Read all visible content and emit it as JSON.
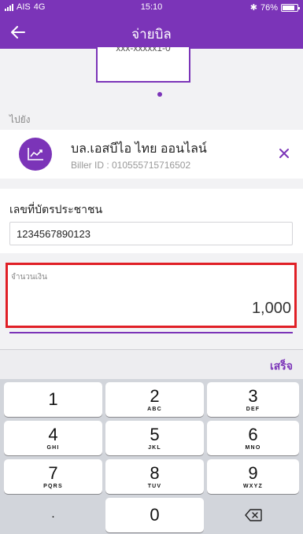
{
  "status_bar": {
    "carrier": "AIS",
    "network": "4G",
    "time": "15:10",
    "battery": "76%"
  },
  "header": {
    "title": "จ่ายบิล",
    "back_icon": "arrow-left-icon"
  },
  "preview": {
    "masked_text": "xxx-xxxxx1-0"
  },
  "destination_label": "ไปยัง",
  "biller": {
    "name": "บล.เอสบีไอ ไทย ออนไลน์",
    "id_text": "Biller ID : 010555715716502",
    "icon": "chart-line-icon",
    "remove_icon": "close-icon"
  },
  "id_card": {
    "label": "เลขที่บัตรประชาชน",
    "value": "1234567890123"
  },
  "amount": {
    "label": "จำนวนเงิน",
    "value": "1,000"
  },
  "keyboard": {
    "done_label": "เสร็จ",
    "keys": [
      {
        "num": "1",
        "letters": ""
      },
      {
        "num": "2",
        "letters": "ABC"
      },
      {
        "num": "3",
        "letters": "DEF"
      },
      {
        "num": "4",
        "letters": "GHI"
      },
      {
        "num": "5",
        "letters": "JKL"
      },
      {
        "num": "6",
        "letters": "MNO"
      },
      {
        "num": "7",
        "letters": "PQRS"
      },
      {
        "num": "8",
        "letters": "TUV"
      },
      {
        "num": "9",
        "letters": "WXYZ"
      },
      {
        "num": ".",
        "letters": ""
      },
      {
        "num": "0",
        "letters": ""
      }
    ],
    "delete_icon": "backspace-icon"
  },
  "colors": {
    "brand": "#7b34b8",
    "highlight": "#e01f26"
  }
}
